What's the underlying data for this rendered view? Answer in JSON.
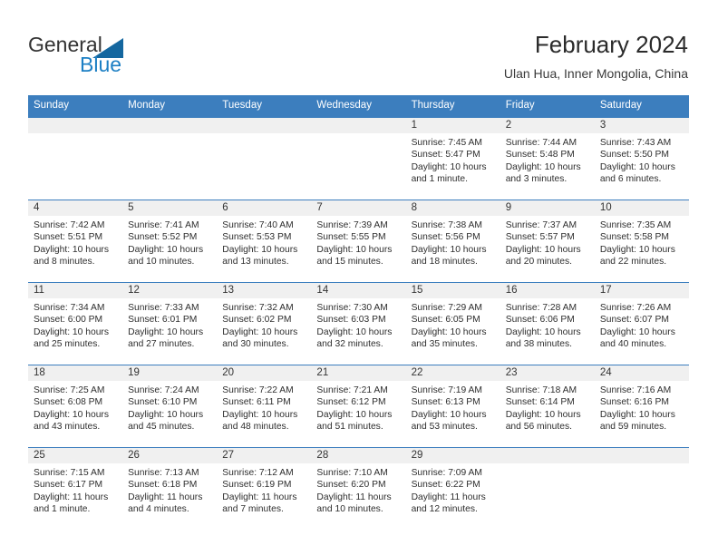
{
  "brand": {
    "name_part1": "General",
    "name_part2": "Blue",
    "accent_color": "#1c7fc4",
    "triangle_color": "#15679f",
    "logo_icon": "triangle-flag-icon"
  },
  "header": {
    "month_title": "February 2024",
    "location": "Ulan Hua, Inner Mongolia, China"
  },
  "theme": {
    "header_row_bg": "#3c7ebe",
    "daynum_band_bg": "#f0f0f0",
    "grid_line": "#3c7ebe",
    "text": "#2e2e2e"
  },
  "calendar": {
    "weekday_headers": [
      "Sunday",
      "Monday",
      "Tuesday",
      "Wednesday",
      "Thursday",
      "Friday",
      "Saturday"
    ],
    "weeks": [
      [
        {
          "day": "",
          "lines": []
        },
        {
          "day": "",
          "lines": []
        },
        {
          "day": "",
          "lines": []
        },
        {
          "day": "",
          "lines": []
        },
        {
          "day": "1",
          "lines": [
            "Sunrise: 7:45 AM",
            "Sunset: 5:47 PM",
            "Daylight: 10 hours",
            "and 1 minute."
          ]
        },
        {
          "day": "2",
          "lines": [
            "Sunrise: 7:44 AM",
            "Sunset: 5:48 PM",
            "Daylight: 10 hours",
            "and 3 minutes."
          ]
        },
        {
          "day": "3",
          "lines": [
            "Sunrise: 7:43 AM",
            "Sunset: 5:50 PM",
            "Daylight: 10 hours",
            "and 6 minutes."
          ]
        }
      ],
      [
        {
          "day": "4",
          "lines": [
            "Sunrise: 7:42 AM",
            "Sunset: 5:51 PM",
            "Daylight: 10 hours",
            "and 8 minutes."
          ]
        },
        {
          "day": "5",
          "lines": [
            "Sunrise: 7:41 AM",
            "Sunset: 5:52 PM",
            "Daylight: 10 hours",
            "and 10 minutes."
          ]
        },
        {
          "day": "6",
          "lines": [
            "Sunrise: 7:40 AM",
            "Sunset: 5:53 PM",
            "Daylight: 10 hours",
            "and 13 minutes."
          ]
        },
        {
          "day": "7",
          "lines": [
            "Sunrise: 7:39 AM",
            "Sunset: 5:55 PM",
            "Daylight: 10 hours",
            "and 15 minutes."
          ]
        },
        {
          "day": "8",
          "lines": [
            "Sunrise: 7:38 AM",
            "Sunset: 5:56 PM",
            "Daylight: 10 hours",
            "and 18 minutes."
          ]
        },
        {
          "day": "9",
          "lines": [
            "Sunrise: 7:37 AM",
            "Sunset: 5:57 PM",
            "Daylight: 10 hours",
            "and 20 minutes."
          ]
        },
        {
          "day": "10",
          "lines": [
            "Sunrise: 7:35 AM",
            "Sunset: 5:58 PM",
            "Daylight: 10 hours",
            "and 22 minutes."
          ]
        }
      ],
      [
        {
          "day": "11",
          "lines": [
            "Sunrise: 7:34 AM",
            "Sunset: 6:00 PM",
            "Daylight: 10 hours",
            "and 25 minutes."
          ]
        },
        {
          "day": "12",
          "lines": [
            "Sunrise: 7:33 AM",
            "Sunset: 6:01 PM",
            "Daylight: 10 hours",
            "and 27 minutes."
          ]
        },
        {
          "day": "13",
          "lines": [
            "Sunrise: 7:32 AM",
            "Sunset: 6:02 PM",
            "Daylight: 10 hours",
            "and 30 minutes."
          ]
        },
        {
          "day": "14",
          "lines": [
            "Sunrise: 7:30 AM",
            "Sunset: 6:03 PM",
            "Daylight: 10 hours",
            "and 32 minutes."
          ]
        },
        {
          "day": "15",
          "lines": [
            "Sunrise: 7:29 AM",
            "Sunset: 6:05 PM",
            "Daylight: 10 hours",
            "and 35 minutes."
          ]
        },
        {
          "day": "16",
          "lines": [
            "Sunrise: 7:28 AM",
            "Sunset: 6:06 PM",
            "Daylight: 10 hours",
            "and 38 minutes."
          ]
        },
        {
          "day": "17",
          "lines": [
            "Sunrise: 7:26 AM",
            "Sunset: 6:07 PM",
            "Daylight: 10 hours",
            "and 40 minutes."
          ]
        }
      ],
      [
        {
          "day": "18",
          "lines": [
            "Sunrise: 7:25 AM",
            "Sunset: 6:08 PM",
            "Daylight: 10 hours",
            "and 43 minutes."
          ]
        },
        {
          "day": "19",
          "lines": [
            "Sunrise: 7:24 AM",
            "Sunset: 6:10 PM",
            "Daylight: 10 hours",
            "and 45 minutes."
          ]
        },
        {
          "day": "20",
          "lines": [
            "Sunrise: 7:22 AM",
            "Sunset: 6:11 PM",
            "Daylight: 10 hours",
            "and 48 minutes."
          ]
        },
        {
          "day": "21",
          "lines": [
            "Sunrise: 7:21 AM",
            "Sunset: 6:12 PM",
            "Daylight: 10 hours",
            "and 51 minutes."
          ]
        },
        {
          "day": "22",
          "lines": [
            "Sunrise: 7:19 AM",
            "Sunset: 6:13 PM",
            "Daylight: 10 hours",
            "and 53 minutes."
          ]
        },
        {
          "day": "23",
          "lines": [
            "Sunrise: 7:18 AM",
            "Sunset: 6:14 PM",
            "Daylight: 10 hours",
            "and 56 minutes."
          ]
        },
        {
          "day": "24",
          "lines": [
            "Sunrise: 7:16 AM",
            "Sunset: 6:16 PM",
            "Daylight: 10 hours",
            "and 59 minutes."
          ]
        }
      ],
      [
        {
          "day": "25",
          "lines": [
            "Sunrise: 7:15 AM",
            "Sunset: 6:17 PM",
            "Daylight: 11 hours",
            "and 1 minute."
          ]
        },
        {
          "day": "26",
          "lines": [
            "Sunrise: 7:13 AM",
            "Sunset: 6:18 PM",
            "Daylight: 11 hours",
            "and 4 minutes."
          ]
        },
        {
          "day": "27",
          "lines": [
            "Sunrise: 7:12 AM",
            "Sunset: 6:19 PM",
            "Daylight: 11 hours",
            "and 7 minutes."
          ]
        },
        {
          "day": "28",
          "lines": [
            "Sunrise: 7:10 AM",
            "Sunset: 6:20 PM",
            "Daylight: 11 hours",
            "and 10 minutes."
          ]
        },
        {
          "day": "29",
          "lines": [
            "Sunrise: 7:09 AM",
            "Sunset: 6:22 PM",
            "Daylight: 11 hours",
            "and 12 minutes."
          ]
        },
        {
          "day": "",
          "lines": []
        },
        {
          "day": "",
          "lines": []
        }
      ]
    ]
  }
}
